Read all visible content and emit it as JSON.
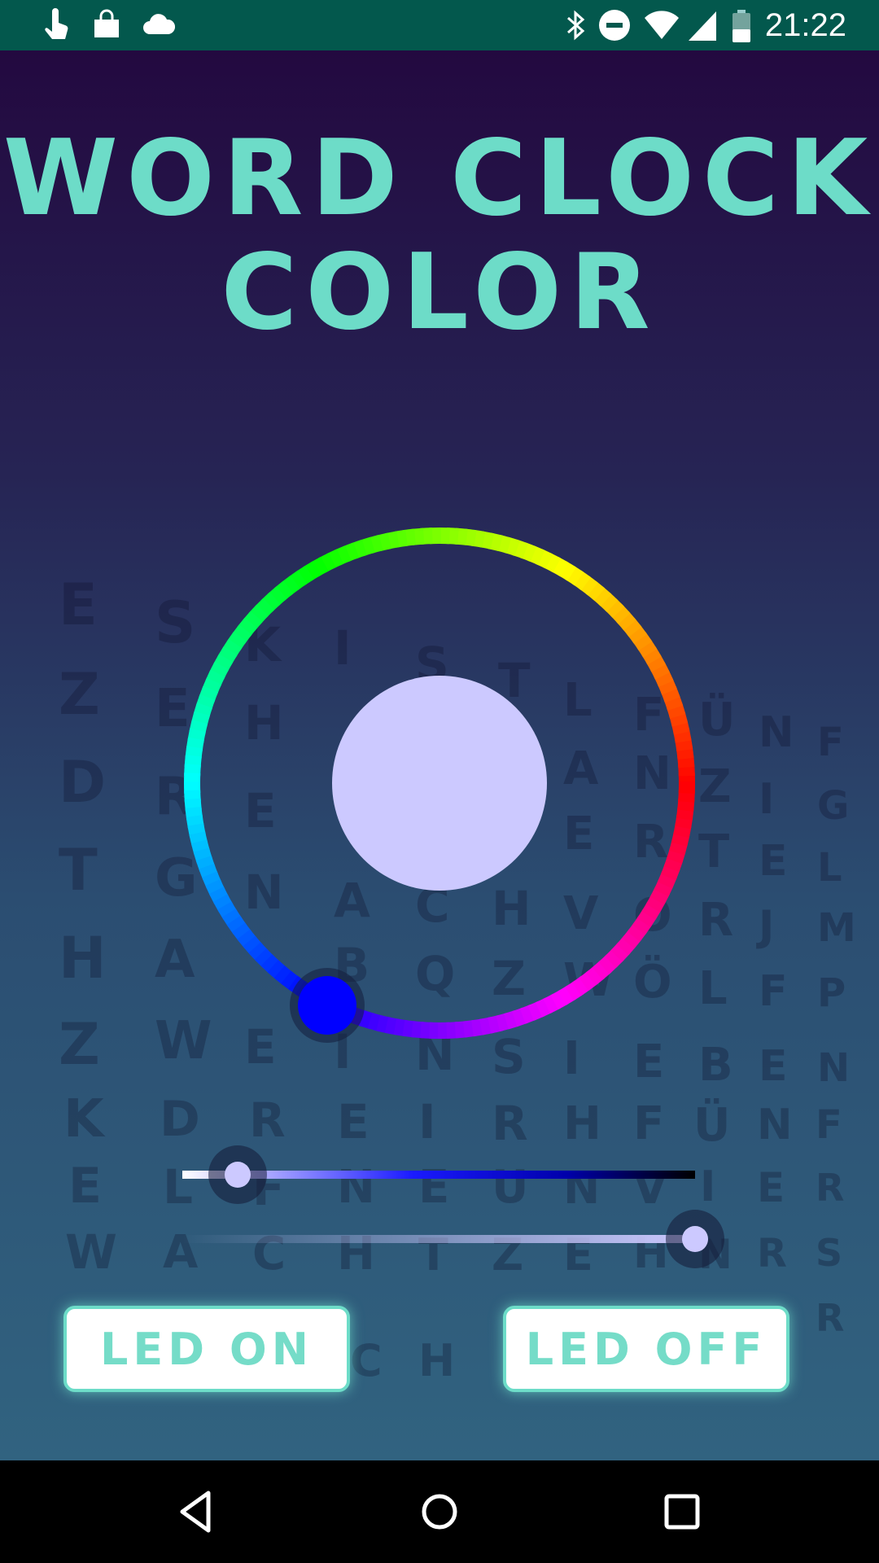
{
  "status_bar": {
    "time": "21:22",
    "left_icons": [
      "touch-icon",
      "shopping-bag-icon",
      "cloud-icon"
    ],
    "right_icons": [
      "bluetooth-icon",
      "do-not-disturb-icon",
      "wifi-icon",
      "cell-signal-icon",
      "battery-icon"
    ]
  },
  "title": {
    "line1": "WORD CLOCK",
    "line2": "COLOR"
  },
  "color_picker": {
    "selected_color": "#0000ff",
    "preview_color": "#ccc9ff",
    "saturation_value": 0.1,
    "opacity_value": 1.0
  },
  "buttons": {
    "led_on": "LED ON",
    "led_off": "LED OFF"
  },
  "nav_bar": {
    "icons": [
      "back-icon",
      "home-icon",
      "recents-icon"
    ]
  },
  "colors": {
    "accent": "#6ddcc8",
    "status_bar": "#03584d"
  }
}
